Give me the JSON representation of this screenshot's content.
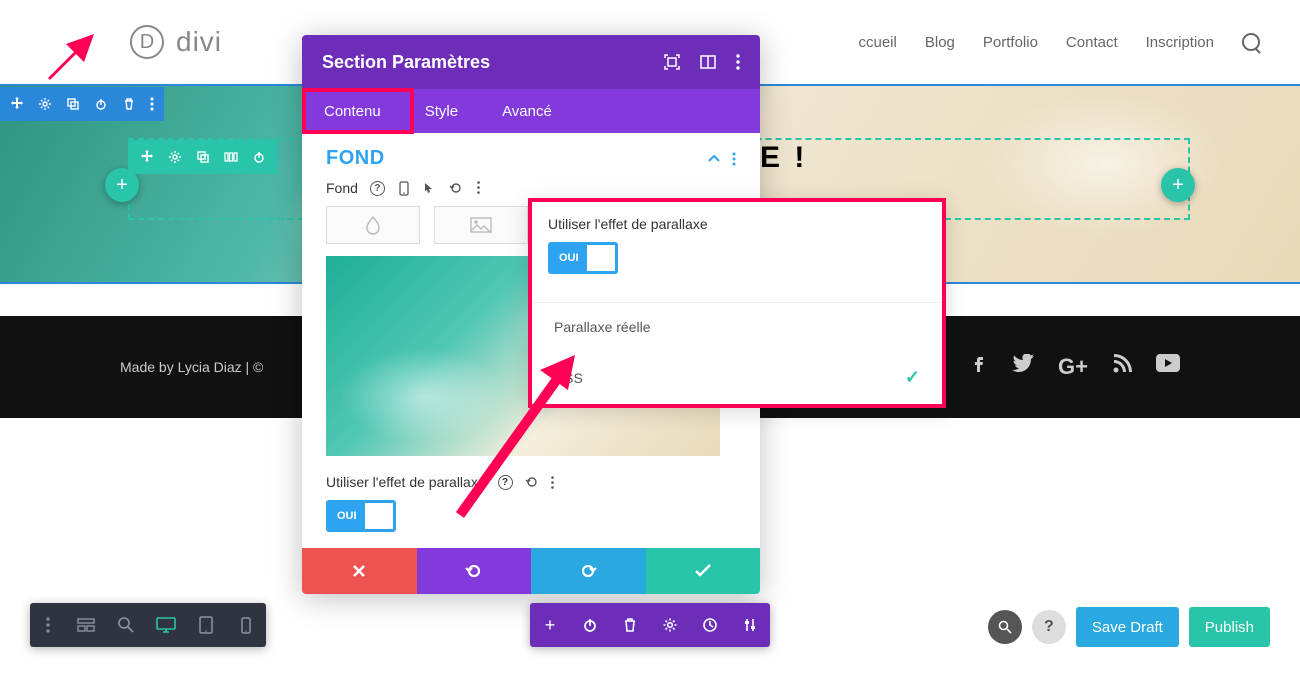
{
  "logo": {
    "initial": "D",
    "text": "divi"
  },
  "nav": {
    "accueil": "ccueil",
    "blog": "Blog",
    "portfolio": "Portfolio",
    "contact": "Contact",
    "inscription": "Inscription"
  },
  "hero": {
    "text_fragment": "E !"
  },
  "footer": {
    "credit": "Made by Lycia Diaz | ©"
  },
  "modal": {
    "title": "Section Paramètres",
    "tabs": {
      "content": "Contenu",
      "style": "Style",
      "advanced": "Avancé"
    },
    "section_title": "FOND",
    "bg_label": "Fond",
    "parallax_label": "Utiliser l'effet de parallaxe",
    "toggle_on": "OUI"
  },
  "popover": {
    "label": "Utiliser l'effet de parallaxe",
    "toggle_on": "OUI",
    "option_real": "Parallaxe réelle",
    "option_css": "CSS"
  },
  "bottom": {
    "save_draft": "Save Draft",
    "publish": "Publish"
  },
  "colors": {
    "purple": "#6c2eb9",
    "purple_light": "#8339dc",
    "blue": "#2ea3f2",
    "teal": "#29c4a9",
    "red": "#ef5350",
    "pink": "#ff0054",
    "section_blue": "#2b87da"
  }
}
